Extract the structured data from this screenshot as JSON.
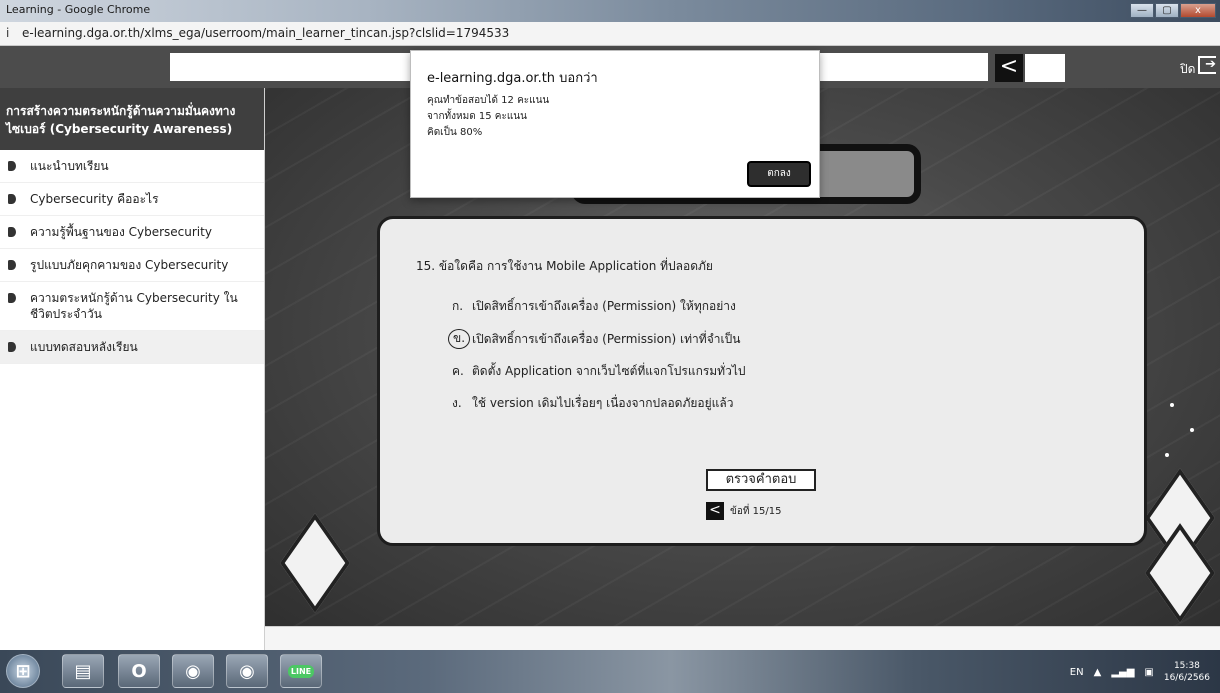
{
  "browser": {
    "window_title": "Learning - Google Chrome",
    "url": "e-learning.dga.or.th/xlms_ega/userroom/main_learner_tincan.jsp?clslid=1794533",
    "win_minimize": "—",
    "win_maximize": "▢",
    "win_close": "x"
  },
  "header": {
    "back_glyph": "<",
    "close_label": "ปิด",
    "close_icon": "exit-icon"
  },
  "sidebar": {
    "course_title": "การสร้างความตระหนักรู้ด้านความมั่นคงทางไซเบอร์ (Cybersecurity Awareness)",
    "items": [
      {
        "label": "แนะนำบทเรียน"
      },
      {
        "label": "Cybersecurity คืออะไร"
      },
      {
        "label": "ความรู้พื้นฐานของ Cybersecurity"
      },
      {
        "label": "รูปแบบภัยคุกคามของ Cybersecurity"
      },
      {
        "label": "ความตระหนักรู้ด้าน Cybersecurity ในชีวิตประจำวัน"
      },
      {
        "label": "แบบทดสอบหลังเรียน"
      }
    ]
  },
  "quiz": {
    "question": "15. ข้อใดคือ การใช้งาน Mobile Application ที่ปลอดภัย",
    "options": [
      {
        "key": "ก.",
        "text": "เปิดสิทธิ์การเข้าถึงเครื่อง (Permission) ให้ทุกอย่าง"
      },
      {
        "key": "ข.",
        "text": "เปิดสิทธิ์การเข้าถึงเครื่อง (Permission) เท่าที่จำเป็น",
        "selected": true
      },
      {
        "key": "ค.",
        "text": "ติดตั้ง Application จากเว็บไซต์ที่แจกโปรแกรมทั่วไป"
      },
      {
        "key": "ง.",
        "text": "ใช้ version เดิมไปเรื่อยๆ เนื่องจากปลอดภัยอยู่แล้ว"
      }
    ],
    "check_button": "ตรวจคำตอบ",
    "prev_glyph": "<",
    "page_indicator": "ข้อที่ 15/15"
  },
  "dialog": {
    "title": "e-learning.dga.or.th บอกว่า",
    "line1": "คุณทำข้อสอบได้ 12 คะแนน",
    "line2": "จากทั้งหมด 15 คะแนน",
    "line3": "คิดเป็น 80%",
    "ok_button": "ตกลง"
  },
  "taskbar": {
    "icons": [
      "windows-start-icon",
      "file-explorer-icon",
      "opera-icon",
      "chrome-icon",
      "chrome-icon",
      "line-icon"
    ],
    "line_label": "LINE",
    "lang": "EN",
    "tray_arrow": "▲",
    "time": "15:38",
    "date": "16/6/2566"
  },
  "colors": {
    "sidebar_header_bg": "#3f3f3f",
    "stage_bg": "#4a4a4a",
    "quiz_bg": "#ececec",
    "accent_dark": "#111111"
  }
}
